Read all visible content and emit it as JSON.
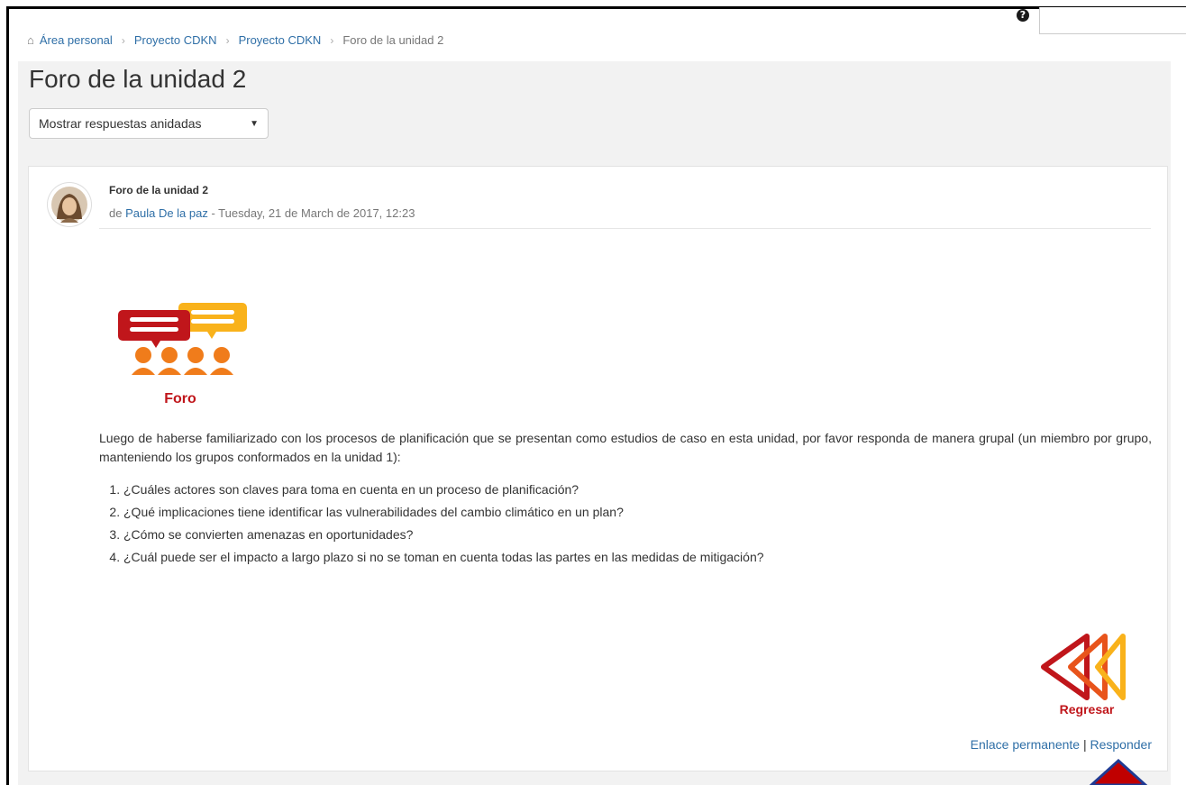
{
  "topbar": {
    "help_icon": "question-circle-icon"
  },
  "breadcrumb": {
    "home_icon": "home-icon",
    "items": [
      "Área personal",
      "Proyecto CDKN",
      "Proyecto CDKN",
      "Foro de la unidad 2"
    ]
  },
  "page": {
    "title": "Foro de la unidad 2"
  },
  "display_mode": {
    "selected": "Mostrar respuestas anidadas"
  },
  "post": {
    "subject": "Foro de la unidad 2",
    "author_prefix": "de ",
    "author": "Paula De la paz",
    "date": " - Tuesday, 21 de March de 2017, 12:23",
    "foro_label": "Foro",
    "intro": "Luego de haberse familiarizado con los procesos de planificación que se presentan como estudios de caso en esta unidad, por favor responda de manera grupal (un miembro por grupo, manteniendo los grupos conformados en la unidad 1):",
    "questions": [
      "¿Cuáles actores son claves para toma en cuenta en un proceso de planificación?",
      "¿Qué implicaciones tiene identificar las vulnerabilidades del cambio climático en un plan?",
      "¿Cómo se convierten amenazas en oportunidades?",
      "¿Cuál puede ser el impacto a largo plazo si no se toman en cuenta todas las partes en las medidas de mitigación?"
    ],
    "back_label": "Regresar",
    "permalink": "Enlace permanente",
    "action_sep": " | ",
    "reply": "Responder"
  },
  "colors": {
    "link": "#2f6fa7",
    "foro_red": "#c0161b",
    "foro_orange": "#f07c1b",
    "foro_yellow": "#f9b21b",
    "arrow_red": "#c00000",
    "arrow_blue": "#1f3a93"
  }
}
